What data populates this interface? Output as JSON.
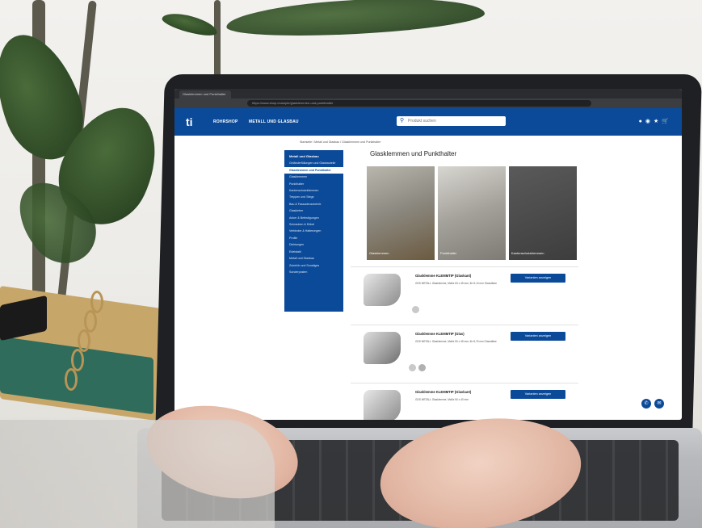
{
  "browser": {
    "tab_title": "Glasklemmen und Punkthalter",
    "url": "https://www.shop.example/glasklemmen-und-punkthalter"
  },
  "site": {
    "logo": "ti",
    "nav": [
      "ROHRSHOP",
      "METALL UND GLASBAU"
    ],
    "search_placeholder": "Produkt suchen",
    "header_icons": [
      "user-icon",
      "account-icon",
      "wishlist-icon",
      "cart-icon"
    ]
  },
  "breadcrumb": "Startseite / Metall und Glasbau / Glasklemmen und Punkthalter",
  "sidebar": {
    "heading": "Metall und Glasbau",
    "items": [
      "Geländerfüllungen und Glasbauteile",
      "Glasklemmen und Punkthalter",
      "Glasklemmen",
      "Punkthalter",
      "Kantenschutzklemmen",
      "Treppen und Stege",
      "Bau & Fassadenzubehör",
      "Glaskleber",
      "Anker & Befestigungen",
      "Schrauben & Dübel",
      "Verbinder & Halterungen",
      "Profile",
      "Dichtungen",
      "Edelstahl",
      "Metall und Glasbau",
      "Zubehör und Sonstiges",
      "Sonderposten"
    ],
    "active_index": 1
  },
  "page": {
    "title": "Glasklemmen und Punkthalter",
    "categories": [
      {
        "label": "Glasklemmen",
        "color": "#8a8a86"
      },
      {
        "label": "Punkthalter",
        "color": "#9a9a94"
      },
      {
        "label": "Kantenschutzklemmen",
        "color": "#4a4a4a"
      }
    ]
  },
  "products": [
    {
      "name": "Glasklemme KLEMMTIP (Glaskant)",
      "desc": "GDS METALL Glasklemme, Maße 63 x 45 mm, für 8-10 mm Glasstärke",
      "button": "Varianten anzeigen",
      "swatches": 1
    },
    {
      "name": "Glasklemme KLEMMTIP (Glas)",
      "desc": "GDS METALL Glasklemme, Maße 50 x 45 mm, für 8,76 mm Glasstärke",
      "button": "Varianten anzeigen",
      "swatches": 2
    },
    {
      "name": "Glasklemme KLEMMTIP (Glaskant)",
      "desc": "GDS METALL Glasklemme, Maße 50 x 40 mm",
      "button": "Varianten anzeigen",
      "swatches": 0
    }
  ],
  "colors": {
    "brand_blue": "#0b4a99",
    "sidebar_bg": "#0b4a99"
  }
}
